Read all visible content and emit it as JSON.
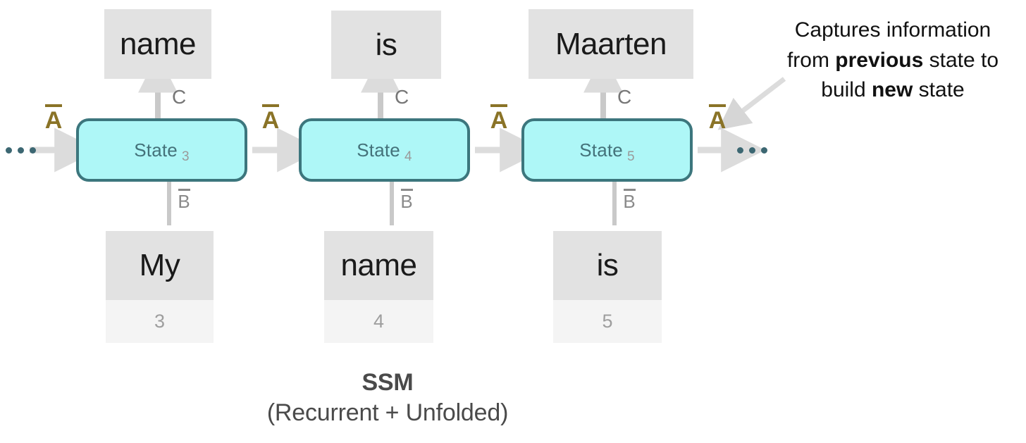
{
  "diagram": {
    "caption_main": "SSM",
    "caption_sub": "(Recurrent + Unfolded)",
    "colors": {
      "state_fill": "#aef7f7",
      "state_border": "#3c767d",
      "state_text": "#44727a",
      "token_box": "#e2e2e2",
      "index_box": "#f4f4f4",
      "a_matrix": "#8a7327",
      "b_matrix": "#8a8a8a",
      "c_matrix": "#767676",
      "arrow": "#dcdcdc",
      "dots": "#3c6772",
      "caption": "#4a4a4a",
      "annotation": "#111111"
    },
    "ellipsis_left": "•••",
    "ellipsis_right": "•••",
    "matrix_labels": {
      "a": "A",
      "b": "B",
      "c": "C"
    },
    "outputs": [
      {
        "text": "name"
      },
      {
        "text": "is"
      },
      {
        "text": "Maarten"
      }
    ],
    "states": [
      {
        "label": "State",
        "index": "3"
      },
      {
        "label": "State",
        "index": "4"
      },
      {
        "label": "State",
        "index": "5"
      }
    ],
    "inputs": [
      {
        "token": "My",
        "index": "3"
      },
      {
        "token": "name",
        "index": "4"
      },
      {
        "token": "is",
        "index": "5"
      }
    ],
    "annotation": {
      "line1_pre": "Captures information",
      "line2_pre": "from ",
      "line2_bold": "previous",
      "line2_post": " state to",
      "line3_pre": "build ",
      "line3_bold": "new",
      "line3_post": " state"
    }
  }
}
